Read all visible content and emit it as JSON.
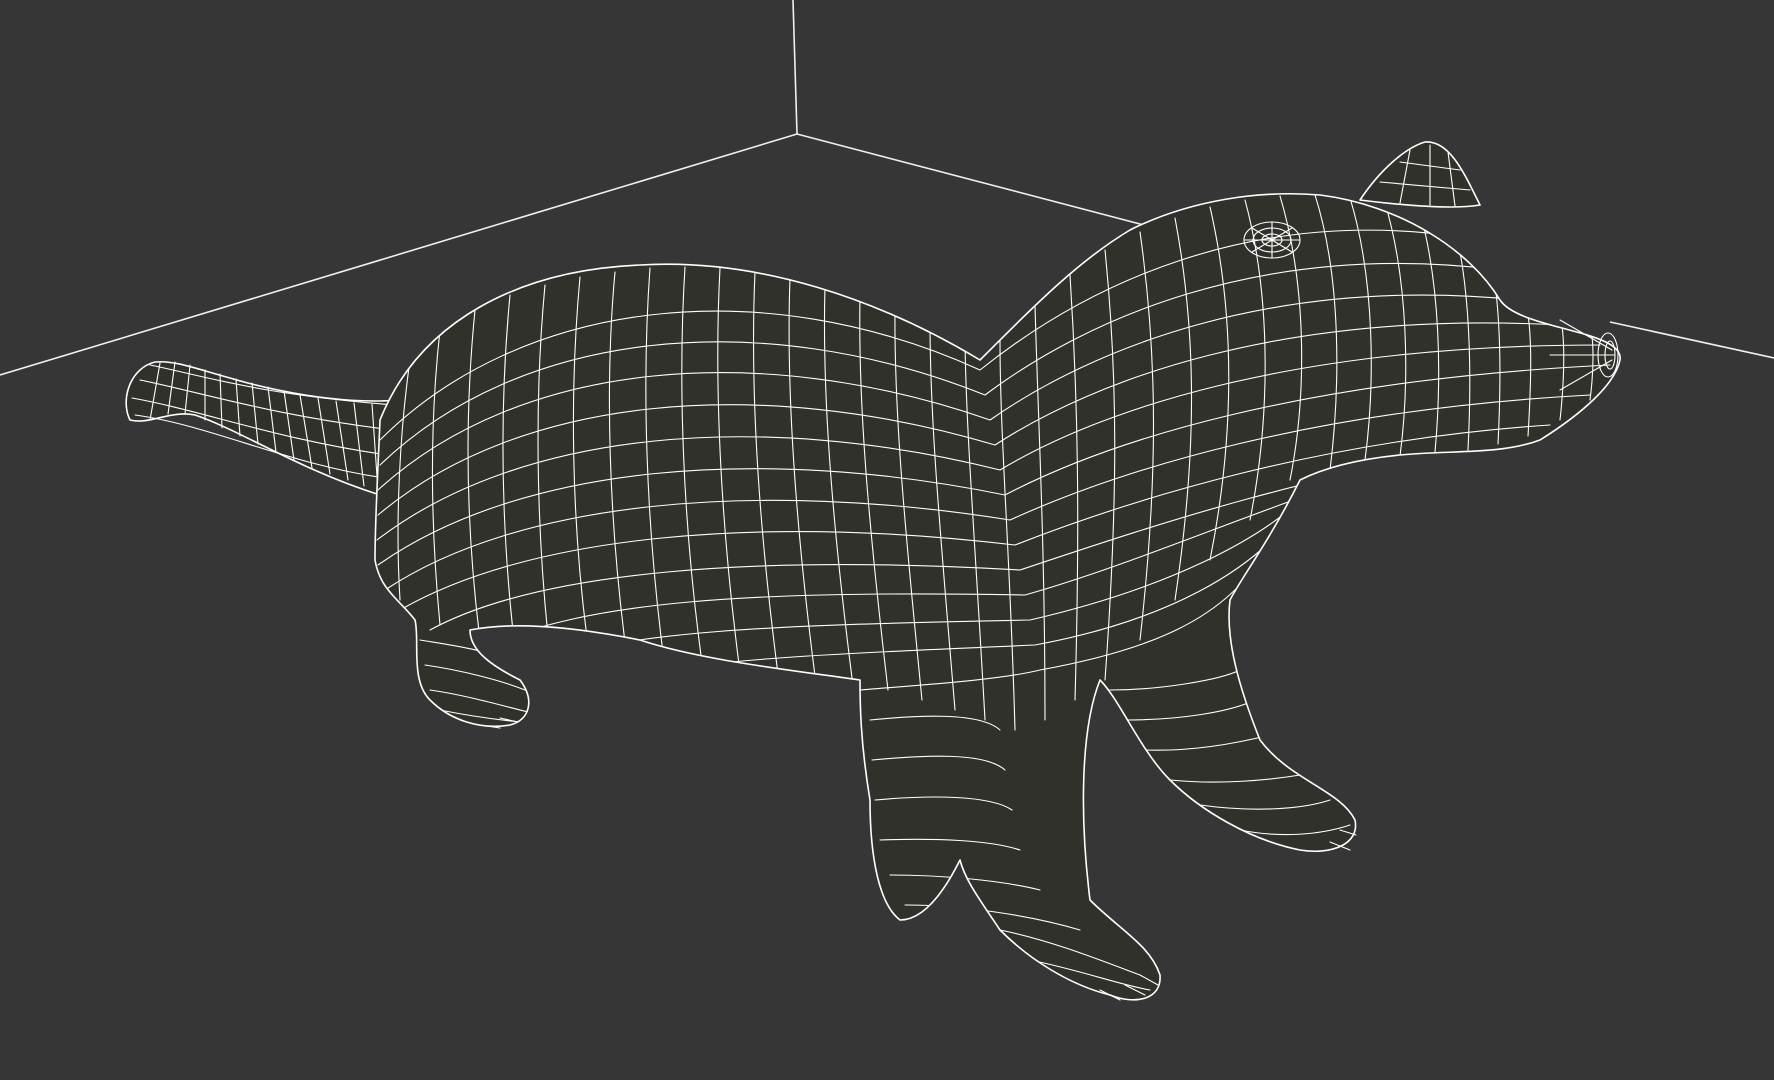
{
  "viewport": {
    "background_color": "#363636",
    "mesh_fill_color": "#31312c",
    "wire_color": "#ffffff",
    "grid_line_color": "#f0f0f0",
    "display_mode": "wireframe"
  }
}
